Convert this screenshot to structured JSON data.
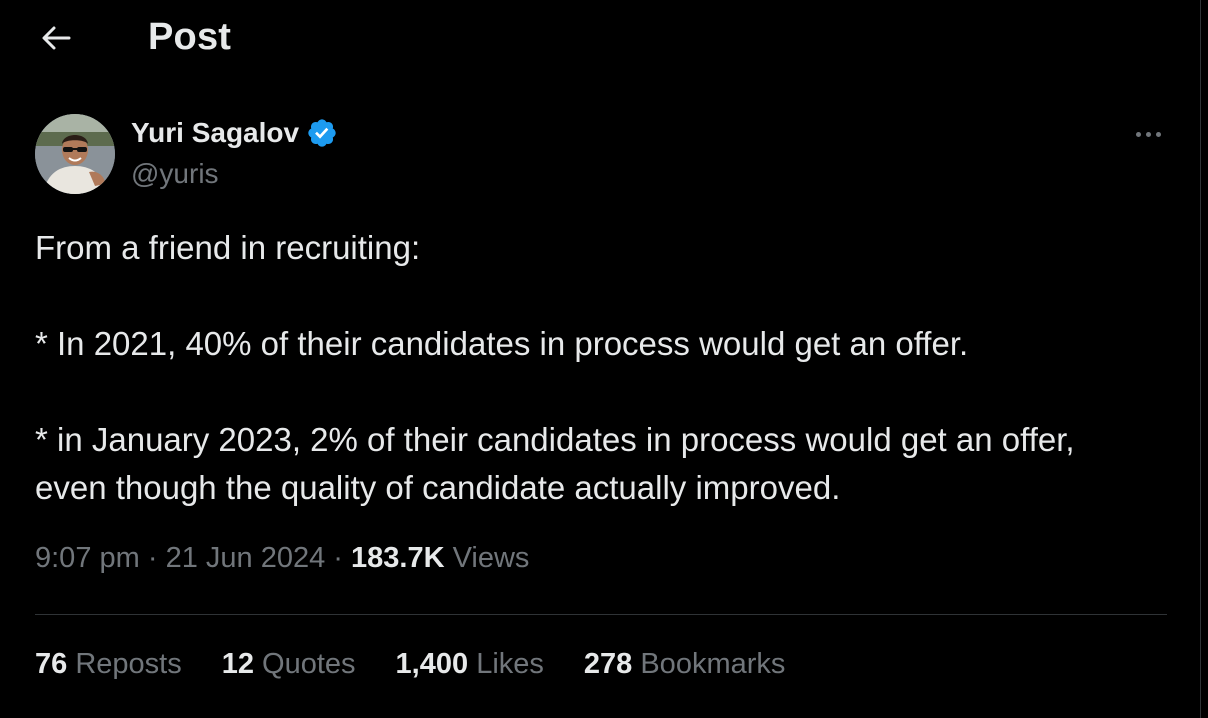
{
  "header": {
    "title": "Post",
    "back_icon": "arrow-left-icon"
  },
  "author": {
    "name": "Yuri Sagalov",
    "handle": "@yuris",
    "verified_color": "#1d9bf0",
    "avatar": "avatar-photo"
  },
  "more_icon": "more-horizontal-icon",
  "tweet": {
    "lines": [
      "From a friend in recruiting:",
      "* In 2021, 40% of their candidates in process would get an offer.",
      "* in January 2023, 2% of their candidates in process would get an offer,",
      "even though the quality of candidate actually improved."
    ]
  },
  "meta": {
    "time": "9:07 pm",
    "separator": " · ",
    "date": "21 Jun 2024",
    "views_count": "183.7K",
    "views_label": "Views"
  },
  "stats": {
    "reposts_count": "76",
    "reposts_label": "Reposts",
    "quotes_count": "12",
    "quotes_label": "Quotes",
    "likes_count": "1,400",
    "likes_label": "Likes",
    "bookmarks_count": "278",
    "bookmarks_label": "Bookmarks"
  },
  "colors": {
    "background": "#000000",
    "text": "#e7e9ea",
    "muted": "#71767b",
    "border": "#2f3336"
  }
}
